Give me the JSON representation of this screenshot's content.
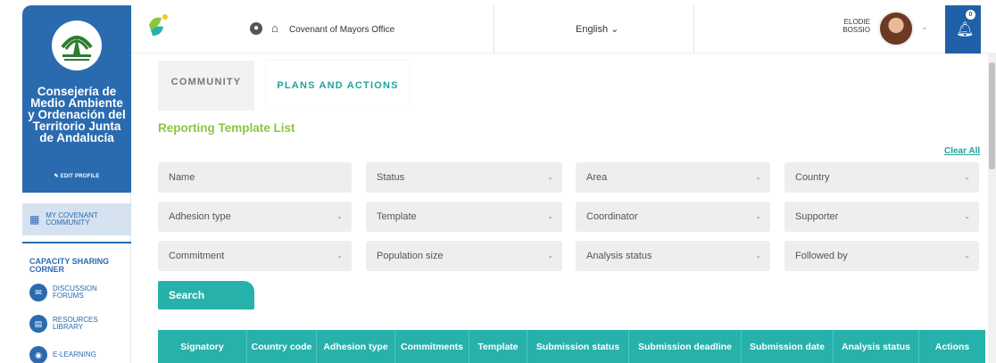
{
  "sidebar": {
    "org_name": "Consejería de Medio Ambiente y Ordenación del Territorio Junta de Andalucía",
    "logo_text": "JUNTA DE ANDALUCIA",
    "edit_profile": "EDIT PROFILE",
    "community_label": "MY COVENANT COMMUNITY",
    "capacity_title": "CAPACITY SHARING CORNER",
    "items": [
      {
        "label": "DISCUSSION FORUMS",
        "icon": "chat-icon"
      },
      {
        "label": "RESOURCES LIBRARY",
        "icon": "document-icon"
      },
      {
        "label": "E-LEARNING",
        "icon": "elearning-icon"
      }
    ]
  },
  "topbar": {
    "office": "Covenant of Mayors Office",
    "language": "English",
    "user_name_line1": "ELODIE",
    "user_name_line2": "BOSSIO",
    "notification_count": "0"
  },
  "tabs": [
    {
      "label": "COMMUNITY"
    },
    {
      "label": "PLANS AND ACTIONS"
    }
  ],
  "page": {
    "title": "Reporting Template List",
    "clear_all": "Clear All",
    "search_label": "Search"
  },
  "filters": [
    {
      "label": "Name"
    },
    {
      "label": "Status"
    },
    {
      "label": "Area"
    },
    {
      "label": "Country"
    },
    {
      "label": "Adhesion type"
    },
    {
      "label": "Template"
    },
    {
      "label": "Coordinator"
    },
    {
      "label": "Supporter"
    },
    {
      "label": "Commitment"
    },
    {
      "label": "Population size"
    },
    {
      "label": "Analysis status"
    },
    {
      "label": "Followed by"
    }
  ],
  "table": {
    "columns": [
      "Signatory",
      "Country code",
      "Adhesion type",
      "Commitments",
      "Template",
      "Submission status",
      "Submission deadline",
      "Submission date",
      "Analysis status",
      "Actions"
    ]
  },
  "colors": {
    "sidebar_blue": "#2a6bb0",
    "teal": "#27b1ab",
    "green_title": "#8cc63f"
  }
}
